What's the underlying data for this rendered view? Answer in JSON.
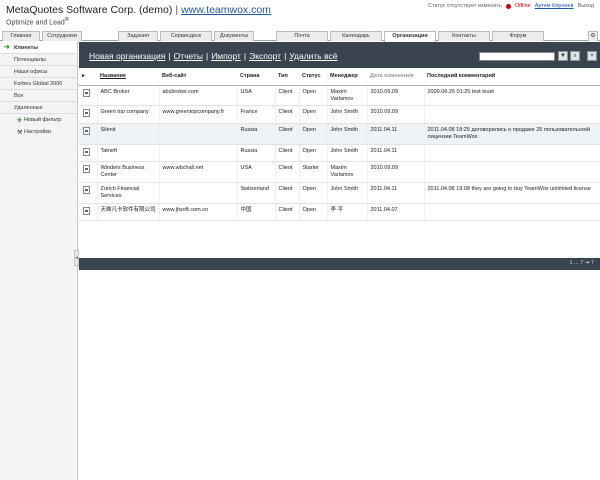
{
  "header": {
    "company": "MetaQuotes Software Corp. (demo)",
    "separator": "|",
    "website": "www.teamwox.com",
    "tagline": "Optimize and Lead",
    "trademark": "®",
    "status_text": "Статус отсутствует изменить",
    "offline": "Offline",
    "user": "Артем Корнеев",
    "exit": "Выход"
  },
  "tabs": [
    "Главная",
    "Сотрудники",
    "Задания",
    "Сервисдеск",
    "Документы",
    "Почта",
    "Календарь",
    "Организации",
    "Контакты",
    "Форум",
    "⚙"
  ],
  "active_tab": "Организации",
  "sidebar": {
    "items": [
      "Клиенты",
      "Потенциалы",
      "Наши офисы",
      "Forbes Global 2000",
      "Все",
      "Удаленные"
    ],
    "new_filter": "Новый фильтр",
    "settings": "Настройки"
  },
  "toolbar": {
    "new_org": "Новая организация",
    "reports": "Отчеты",
    "import": "Импорт",
    "export": "Экспорт",
    "delete_all": "Удалить всё",
    "sep": "|"
  },
  "table": {
    "columns": [
      "Название",
      "Веб-сайт",
      "Страна",
      "Тип",
      "Статус",
      "Менеджер",
      "Дата изменения",
      "Последний комментарий"
    ],
    "rows": [
      [
        "ABC Broker",
        "abcbroker.com",
        "USA",
        "Client",
        "Open",
        "Maxim Varlamov",
        "2010.09.09",
        "2009.06.26 01:25  test tesst"
      ],
      [
        "Green top company",
        "www.greentopcompany.fr",
        "France",
        "Client",
        "Open",
        "John Smith",
        "2010.09.09",
        ""
      ],
      [
        "Silenit",
        "",
        "Russia",
        "Client",
        "Open",
        "John Smith",
        "2011.04.11",
        "2011.04.08 18:25  договорились о продаже 25 пользовательской лицензии TeamWox."
      ],
      [
        "Tatneft",
        "",
        "Russia",
        "Client",
        "Open",
        "John Smith",
        "2011.04.11",
        ""
      ],
      [
        "Winders Business Center",
        "www.wbchall.net",
        "USA",
        "Client",
        "Starter",
        "Maxim Varlamov",
        "2010.09.09",
        ""
      ],
      [
        "Zurich Financial Services",
        "",
        "Switzerland",
        "Client",
        "Open",
        "John Smith",
        "2011.04.11",
        "2011.04.08 19:08  they are going to buy TeamWox unlimited license"
      ],
      [
        "天维凡卡软件有限公司",
        "www.jhsoft.com.cn",
        "中国",
        "Client",
        "Open",
        "李 平",
        "2011.04.07",
        ""
      ]
    ]
  },
  "pager": "1 ... 7  ⇥ 7"
}
